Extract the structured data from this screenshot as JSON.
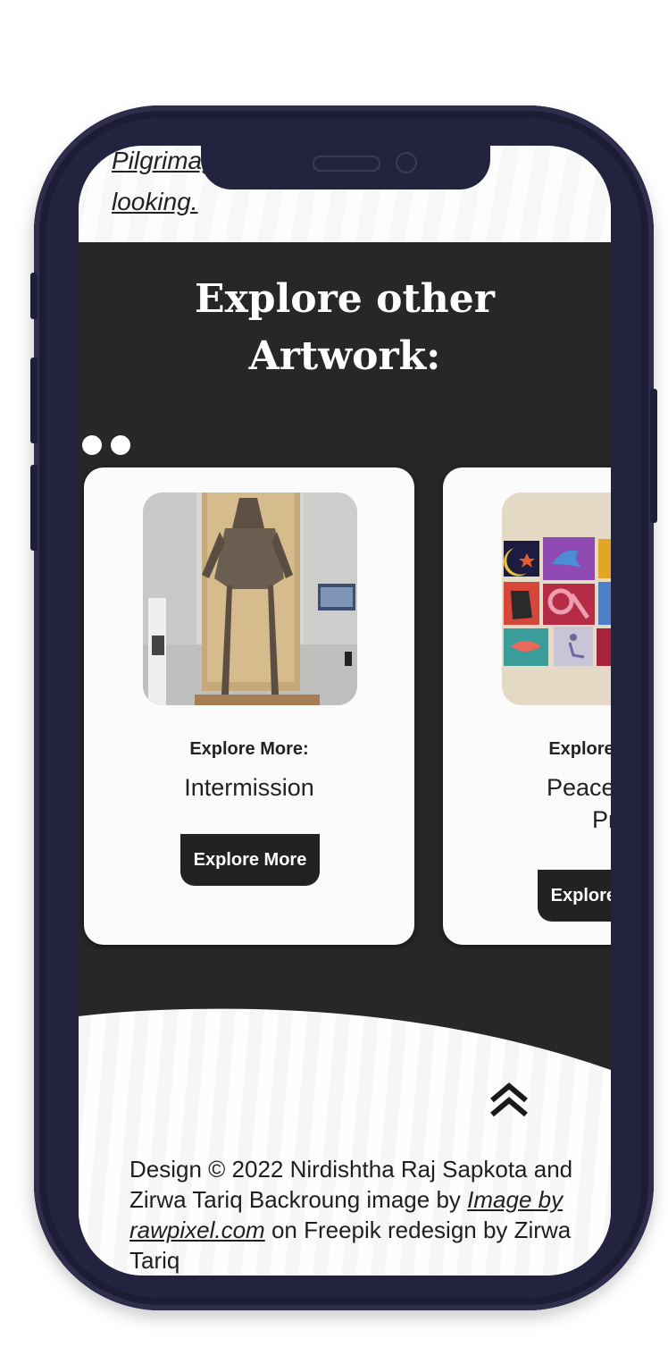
{
  "intro": {
    "link_line1": "Pilgrimage of looking / The Art of",
    "link_line2": "looking.",
    "trailing_dot": "."
  },
  "section": {
    "heading_line1": "Explore other",
    "heading_line2": "Artwork:"
  },
  "cards": [
    {
      "kicker": "Explore More:",
      "title": "Intermission",
      "button": "Explore More",
      "image": "sculpture-photo"
    },
    {
      "kicker": "Explore More:",
      "title_line1": "Peace Sign",
      "title_line2": "Project",
      "button": "Explore More",
      "image": "quilt-photo"
    }
  ],
  "pagination": {
    "pages": 2,
    "active": 1
  },
  "footer": {
    "text_part1": "Design © 2022 Nirdishtha Raj Sapkota and Zirwa Tariq Backroung image by ",
    "link": "Image by rawpixel.com",
    "text_part2": " on Freepik redesign by Zirwa Tariq",
    "back_to_top_icon": "double-chevron-up-icon"
  },
  "colors": {
    "frame": "#24233f",
    "dark_section": "#272727",
    "card": "#fbfbfb",
    "button": "#222222"
  }
}
